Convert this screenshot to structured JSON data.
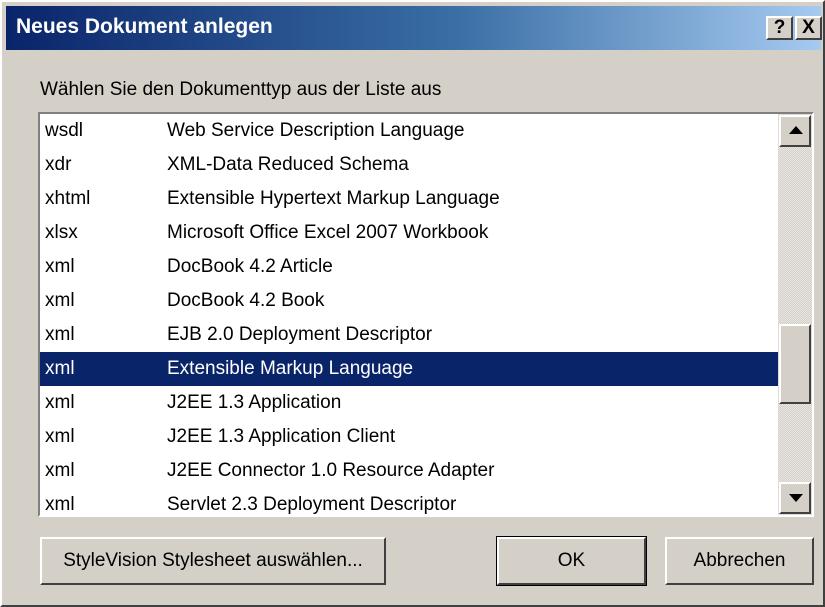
{
  "dialog": {
    "title": "Neues Dokument anlegen",
    "help_label": "?",
    "close_label": "X",
    "prompt": "Wählen Sie den Dokumenttyp aus der Liste aus"
  },
  "list": {
    "selected_index": 7,
    "items": [
      {
        "ext": "wsdl",
        "desc": "Web Service Description Language"
      },
      {
        "ext": "xdr",
        "desc": "XML-Data Reduced Schema"
      },
      {
        "ext": "xhtml",
        "desc": "Extensible Hypertext Markup Language"
      },
      {
        "ext": "xlsx",
        "desc": "Microsoft Office Excel 2007 Workbook"
      },
      {
        "ext": "xml",
        "desc": "DocBook 4.2 Article"
      },
      {
        "ext": "xml",
        "desc": "DocBook 4.2 Book"
      },
      {
        "ext": "xml",
        "desc": "EJB 2.0 Deployment Descriptor"
      },
      {
        "ext": "xml",
        "desc": "Extensible Markup Language"
      },
      {
        "ext": "xml",
        "desc": "J2EE 1.3 Application"
      },
      {
        "ext": "xml",
        "desc": "J2EE 1.3 Application Client"
      },
      {
        "ext": "xml",
        "desc": "J2EE Connector 1.0 Resource Adapter"
      },
      {
        "ext": "xml",
        "desc": "Servlet 2.3 Deployment Descriptor"
      }
    ]
  },
  "buttons": {
    "stylevision": "StyleVision Stylesheet auswählen...",
    "ok": "OK",
    "cancel": "Abbrechen"
  },
  "colors": {
    "selection": "#0a246a",
    "titlebar_start": "#0a246a",
    "titlebar_end": "#a6caf0"
  }
}
